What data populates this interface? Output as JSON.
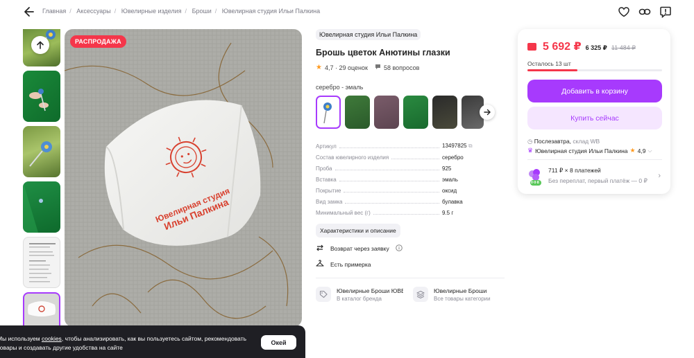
{
  "header": {
    "breadcrumbs": [
      "Главная",
      "Аксессуары",
      "Ювелирные изделия",
      "Броши",
      "Ювелирная студия Ильи Палкина"
    ],
    "icons": [
      "back-arrow-icon",
      "heart-icon",
      "link-icon",
      "report-icon"
    ]
  },
  "gallery": {
    "sale_badge": "РАСПРОДАЖА",
    "box_text_line1": "Ювелирная студия",
    "box_text_line2": "Ильи Палкина"
  },
  "product": {
    "brand": "Ювелирная студия Ильи Палкина",
    "title": "Брошь цветок Анютины глазки",
    "rating": "4,7 · 29 оценок",
    "questions": "58 вопросов",
    "variant": "серебро - эмаль",
    "specs": [
      {
        "k": "Артикул",
        "v": "13497825"
      },
      {
        "k": "Состав ювелирного изделия",
        "v": "серебро"
      },
      {
        "k": "Проба",
        "v": "925"
      },
      {
        "k": "Вставка",
        "v": "эмаль"
      },
      {
        "k": "Покрытие",
        "v": "оксид"
      },
      {
        "k": "Вид замка",
        "v": "булавка"
      },
      {
        "k": "Минимальный вес (г)",
        "v": "9.5 г"
      }
    ],
    "char_button": "Характеристики и описание",
    "return_label": "Возврат через заявку",
    "fitting_label": "Есть примерка",
    "brand_card": {
      "title": "Ювелирные Броши ЮВЕ",
      "sub": "В каталог бренда"
    },
    "category_card": {
      "title": "Ювелирные Броши",
      "sub": "Все товары категории"
    }
  },
  "buy": {
    "price": "5 692 ₽",
    "price2": "6 325 ₽",
    "old_price": "11 484 ₽",
    "stock": "Осталось 13 шт",
    "stock_fraction": 0.37,
    "add_to_cart": "Добавить в корзину",
    "buy_now": "Купить сейчас",
    "delivery": "Послезавтра,",
    "warehouse": "склад WB",
    "seller": "Ювелирная студия Ильи Палкина",
    "seller_rating": "4,9",
    "installment": "711 ₽ × 8 платежей",
    "installment_sub": "Без переплат, первый платёж — 0 ₽",
    "installment_badge": "0·0·8"
  },
  "cookie": {
    "text_prefix": "Мы используем ",
    "link": "cookies",
    "text_suffix": ", чтобы анализировать, как вы пользуетесь сайтом, рекомендовать товары и создавать другие удобства на сайте",
    "ok": "Окей"
  },
  "colors": {
    "accent": "#a73afd",
    "price": "#f5364a"
  }
}
